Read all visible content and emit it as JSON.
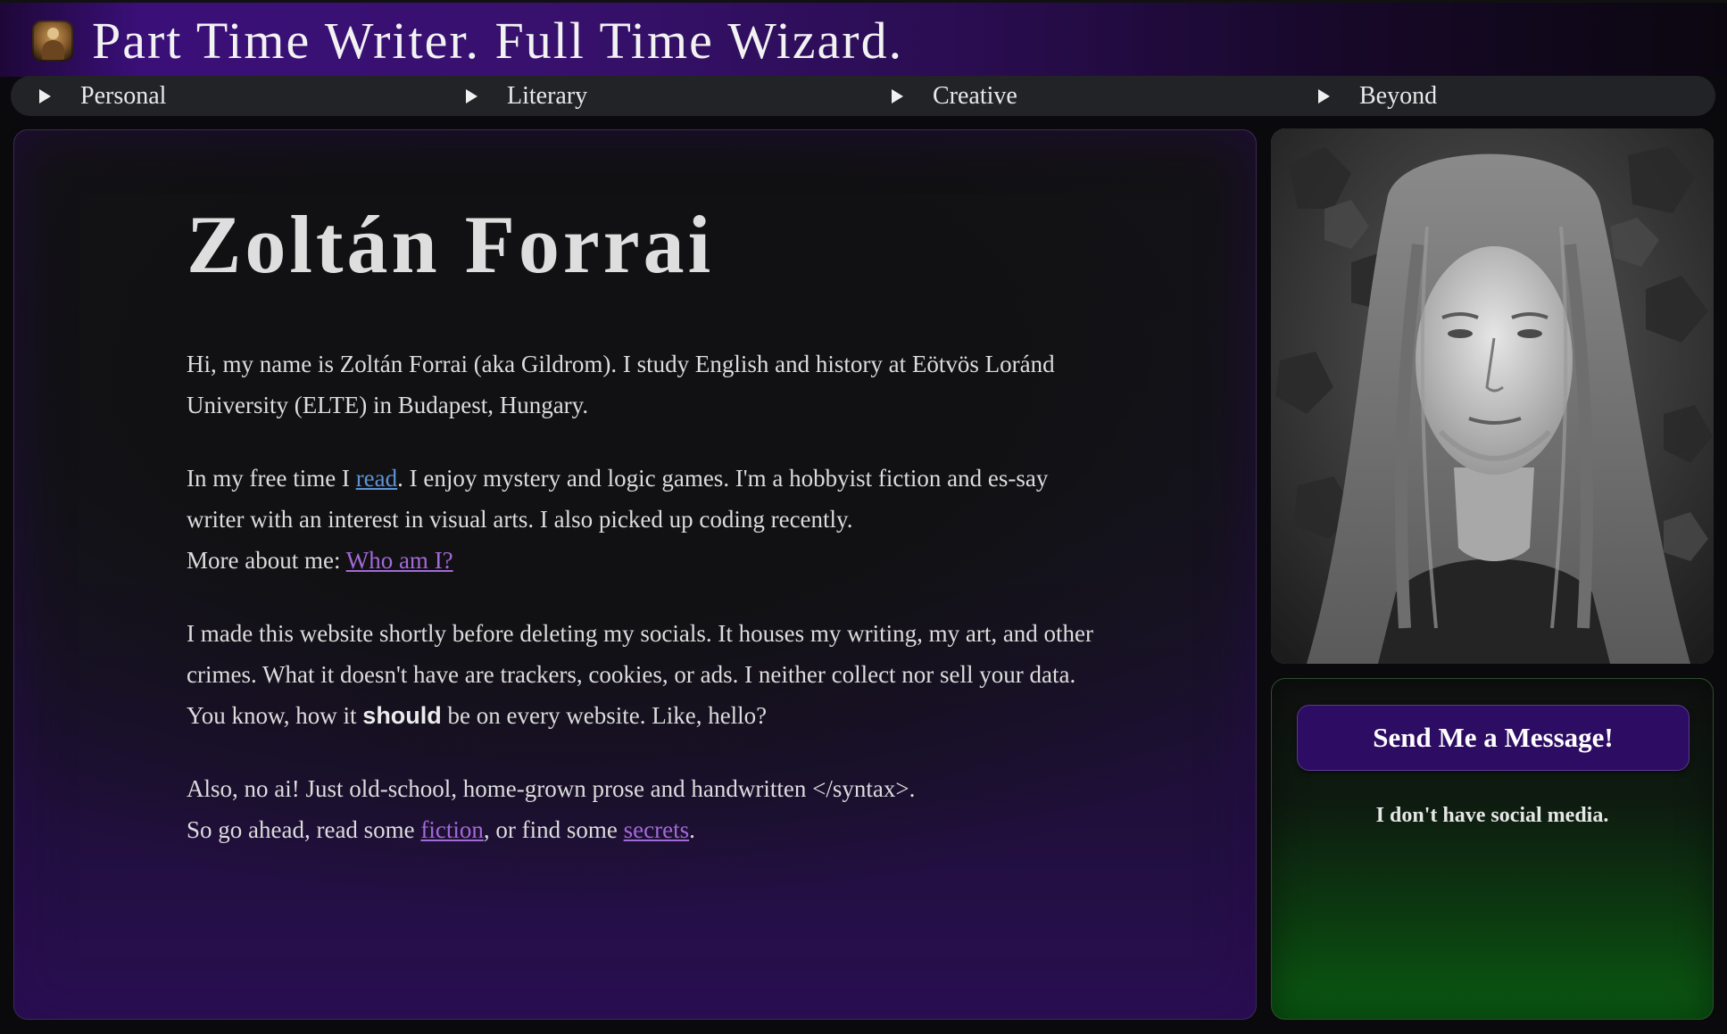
{
  "header": {
    "title": "Part Time Writer. Full Time Wizard.",
    "logo_icon": "wizard-avatar-icon"
  },
  "nav": {
    "items": [
      {
        "label": "Personal",
        "icon": "triangle-right-icon"
      },
      {
        "label": "Literary",
        "icon": "triangle-right-icon"
      },
      {
        "label": "Creative",
        "icon": "triangle-right-icon"
      },
      {
        "label": "Beyond",
        "icon": "triangle-right-icon"
      }
    ]
  },
  "main": {
    "heading": "Zoltán Forrai",
    "p1": "Hi, my name is Zoltán Forrai (aka Gildrom). I study English and history at Eötvös Loránd University (ELTE) in Budapest, Hungary.",
    "p2_before": "In my free time I ",
    "p2_link": "read",
    "p2_after": ". I enjoy mystery and logic games. I'm a hobbyist fiction and es-say writer with an interest in visual arts. I also picked up coding recently.",
    "p2_more": "More about me: ",
    "p2_more_link": "Who am I?",
    "p3_before": "I made this website shortly before deleting my socials. It houses my writing, my art, and other crimes. What it doesn't have are trackers, cookies, or ads. I neither collect nor sell your data. You know, how it ",
    "p3_strong": "should",
    "p3_after": " be on every website. Like, hello?",
    "p4_line1": "Also, no ai! Just old-school, home-grown prose and handwritten </syntax>.",
    "p4_before": "So go ahead, read some ",
    "p4_link1": "fiction",
    "p4_mid": ", or find some ",
    "p4_link2": "secrets",
    "p4_after": "."
  },
  "sidebar": {
    "portrait_alt": "portrait-photo",
    "message_button": "Send Me a Message!",
    "no_social": "I don't have social media."
  },
  "colors": {
    "accent_purple": "#3a0f78",
    "link_blue": "#5f93d6",
    "link_purple": "#a26ad8",
    "button_bg": "#2d0d63",
    "contact_green": "#0a5a12"
  }
}
